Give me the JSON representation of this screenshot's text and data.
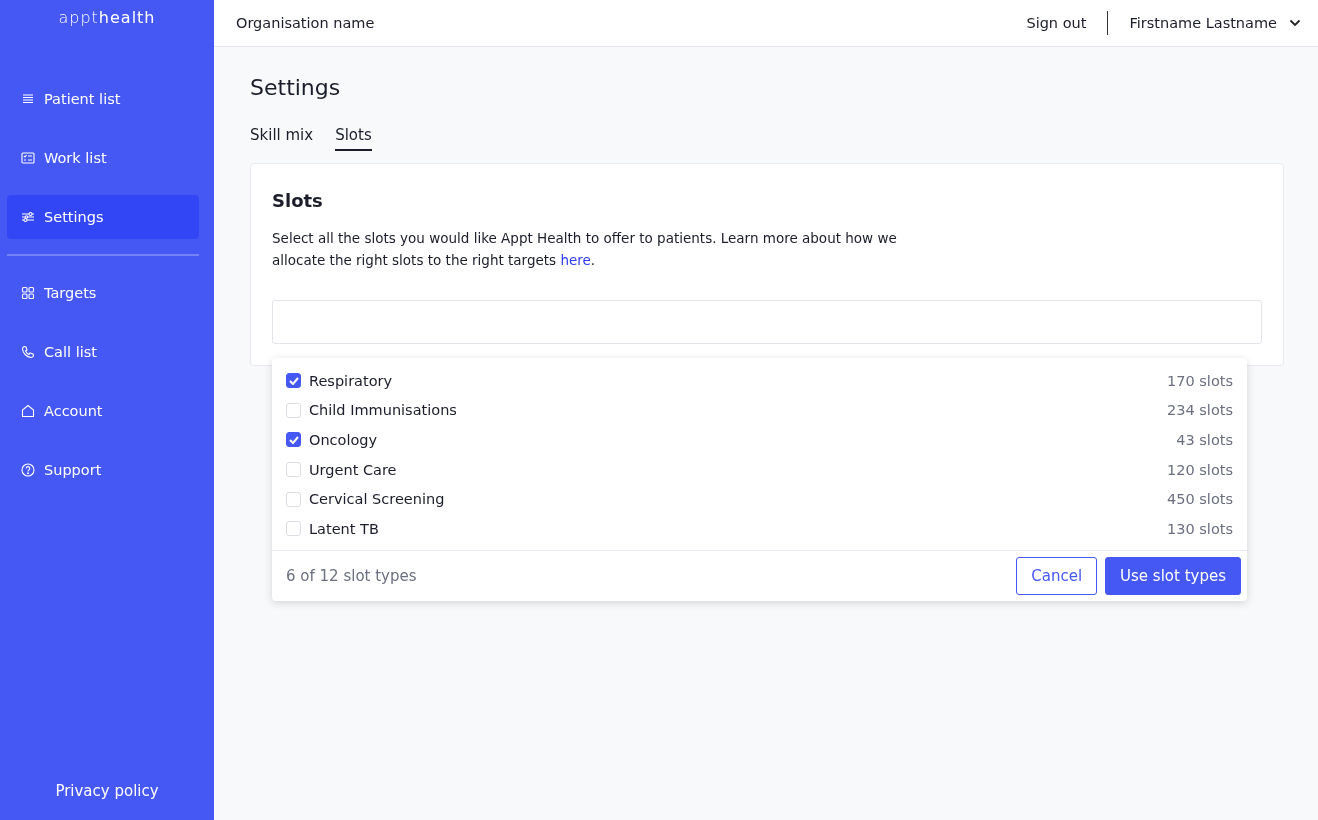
{
  "sidebar": {
    "logo": "appt**health**",
    "items": [
      {
        "label": "Patient list",
        "selected": false
      },
      {
        "label": "Work list",
        "selected": false
      },
      {
        "label": "Settings",
        "selected": true
      },
      {
        "label": "Targets",
        "selected": false,
        "divider_before": true
      },
      {
        "label": "Call list",
        "selected": false
      },
      {
        "label": "Account",
        "selected": false
      },
      {
        "label": "Support",
        "selected": false
      }
    ],
    "footer_link": "Privacy policy"
  },
  "header": {
    "organisation": "Organisation name",
    "sign_out": "Sign out",
    "user": "Firstname Lastname"
  },
  "page": {
    "title": "Settings",
    "tabs": [
      {
        "label": "Skill mix",
        "selected": false
      },
      {
        "label": "Slots",
        "selected": true
      }
    ],
    "card": {
      "title": "Slots",
      "description": "Select all the slots you would like Appt Health to offer to patients. Learn more about how we allocate the right slots to the right targets ",
      "link": "here",
      "link_suffix": ".",
      "dropdown": {
        "options": [
          {
            "label": "Respiratory",
            "count": "170 slots",
            "checked": true
          },
          {
            "label": "Child Immunisations",
            "count": "234 slots",
            "checked": false
          },
          {
            "label": "Oncology",
            "count": "43 slots",
            "checked": true
          },
          {
            "label": "Urgent Care",
            "count": "120 slots",
            "checked": false
          },
          {
            "label": "Cervical Screening",
            "count": "450 slots",
            "checked": false
          },
          {
            "label": "Latent TB",
            "count": "130 slots",
            "checked": false
          }
        ],
        "summary": "6 of 12 slot types",
        "cancel": "Cancel",
        "confirm": "Use slot types"
      }
    }
  }
}
